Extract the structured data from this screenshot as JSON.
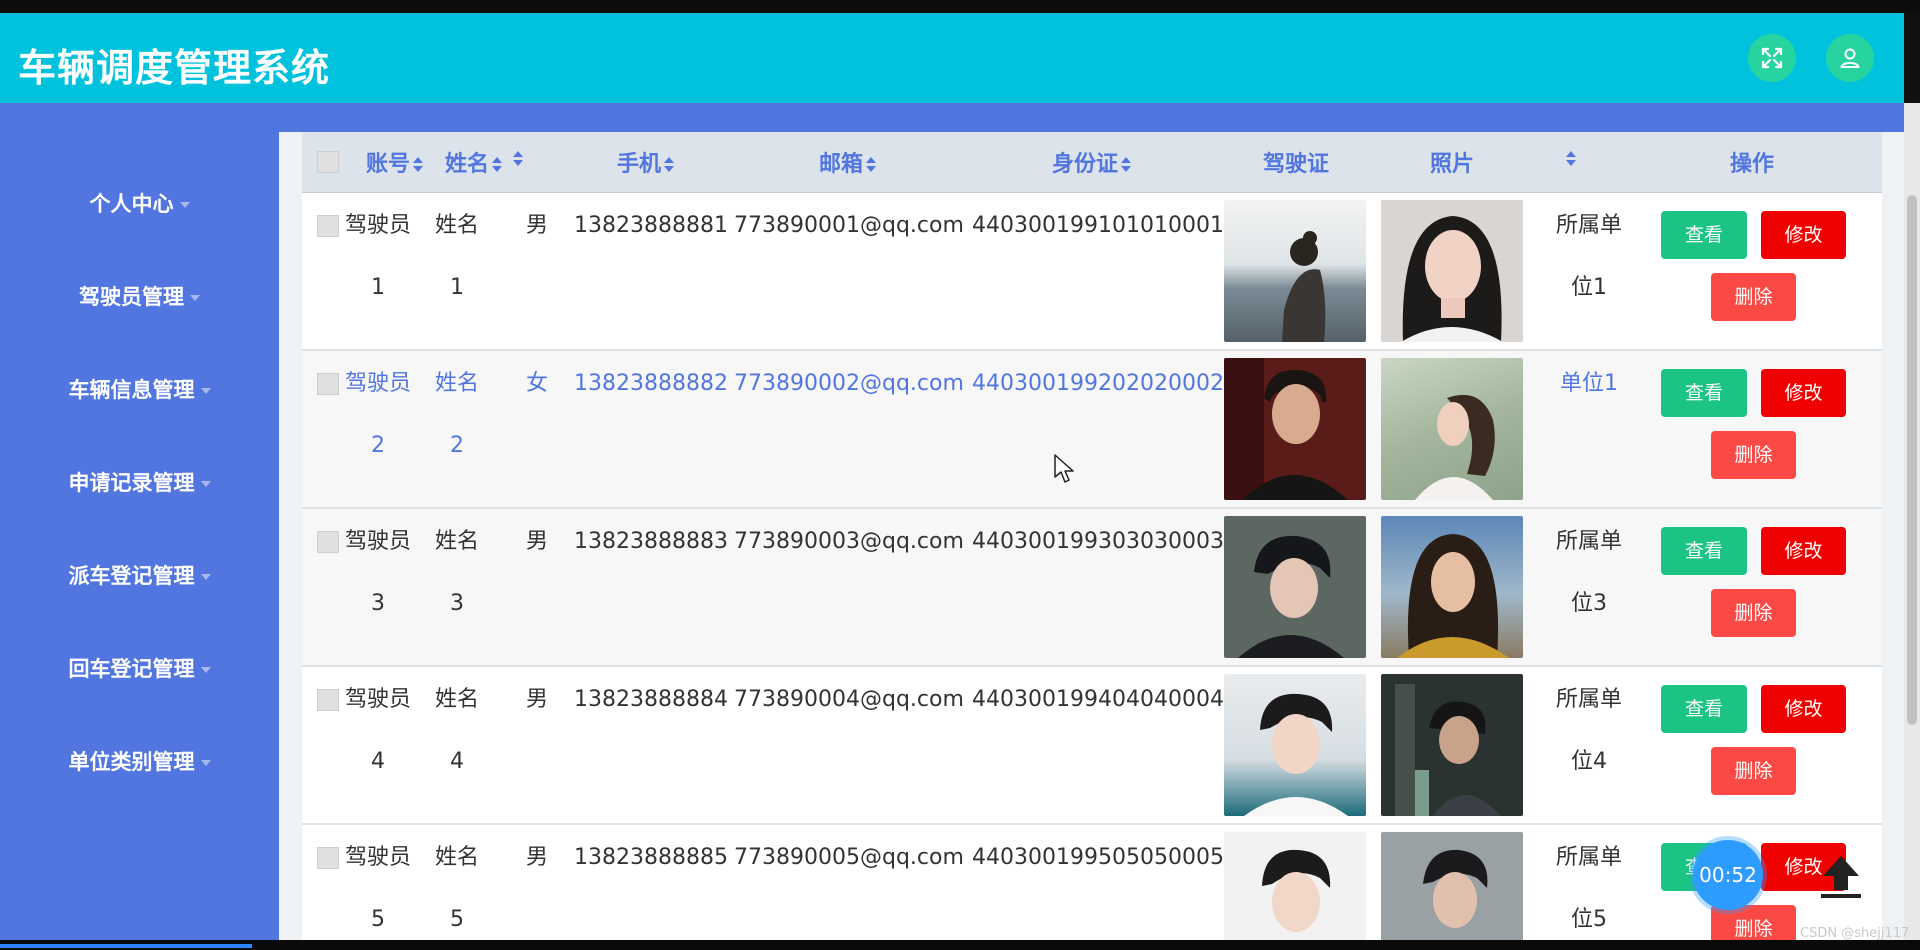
{
  "app": {
    "title": "车辆调度管理系统"
  },
  "header": {
    "fullscreen_icon": "expand-arrows-icon",
    "user_icon": "user-icon"
  },
  "sidebar": {
    "items": [
      {
        "label": "个人中心"
      },
      {
        "label": "驾驶员管理"
      },
      {
        "label": "车辆信息管理"
      },
      {
        "label": "申请记录管理"
      },
      {
        "label": "派车登记管理"
      },
      {
        "label": "回车登记管理"
      },
      {
        "label": "单位类别管理"
      }
    ]
  },
  "table": {
    "columns": {
      "account": "账号",
      "name": "姓名",
      "gender": "",
      "phone": "手机",
      "email": "邮箱",
      "id_card": "身份证",
      "license": "驾驶证",
      "photo": "照片",
      "unit": "",
      "actions": "操作"
    },
    "buttons": {
      "view": "查看",
      "edit": "修改",
      "delete": "删除"
    },
    "rows": [
      {
        "account_a": "驾驶员",
        "account_b": "1",
        "name_a": "姓名",
        "name_b": "1",
        "gender": "男",
        "phone": "13823888881",
        "email": "773890001@qq.com",
        "id_card": "440300199101010001",
        "unit_a": "所属单",
        "unit_b": "位1"
      },
      {
        "account_a": "驾驶员",
        "account_b": "2",
        "name_a": "姓名",
        "name_b": "2",
        "gender": "女",
        "phone": "13823888882",
        "email": "773890002@qq.com",
        "id_card": "440300199202020002",
        "unit_a": "单位1",
        "unit_b": ""
      },
      {
        "account_a": "驾驶员",
        "account_b": "3",
        "name_a": "姓名",
        "name_b": "3",
        "gender": "男",
        "phone": "13823888883",
        "email": "773890003@qq.com",
        "id_card": "440300199303030003",
        "unit_a": "所属单",
        "unit_b": "位3"
      },
      {
        "account_a": "驾驶员",
        "account_b": "4",
        "name_a": "姓名",
        "name_b": "4",
        "gender": "男",
        "phone": "13823888884",
        "email": "773890004@qq.com",
        "id_card": "440300199404040004",
        "unit_a": "所属单",
        "unit_b": "位4"
      },
      {
        "account_a": "驾驶员",
        "account_b": "5",
        "name_a": "姓名",
        "name_b": "5",
        "gender": "男",
        "phone": "13823888885",
        "email": "773890005@qq.com",
        "id_card": "440300199505050005",
        "unit_a": "所属单",
        "unit_b": "位5"
      }
    ]
  },
  "overlay": {
    "timer": "00:52",
    "watermark": "CSDN @shejj117"
  },
  "colors": {
    "header": "#00c2dc",
    "sidebar": "#5276e0",
    "view": "#1bc482",
    "edit": "#f00000",
    "delete": "#fb4a45"
  }
}
